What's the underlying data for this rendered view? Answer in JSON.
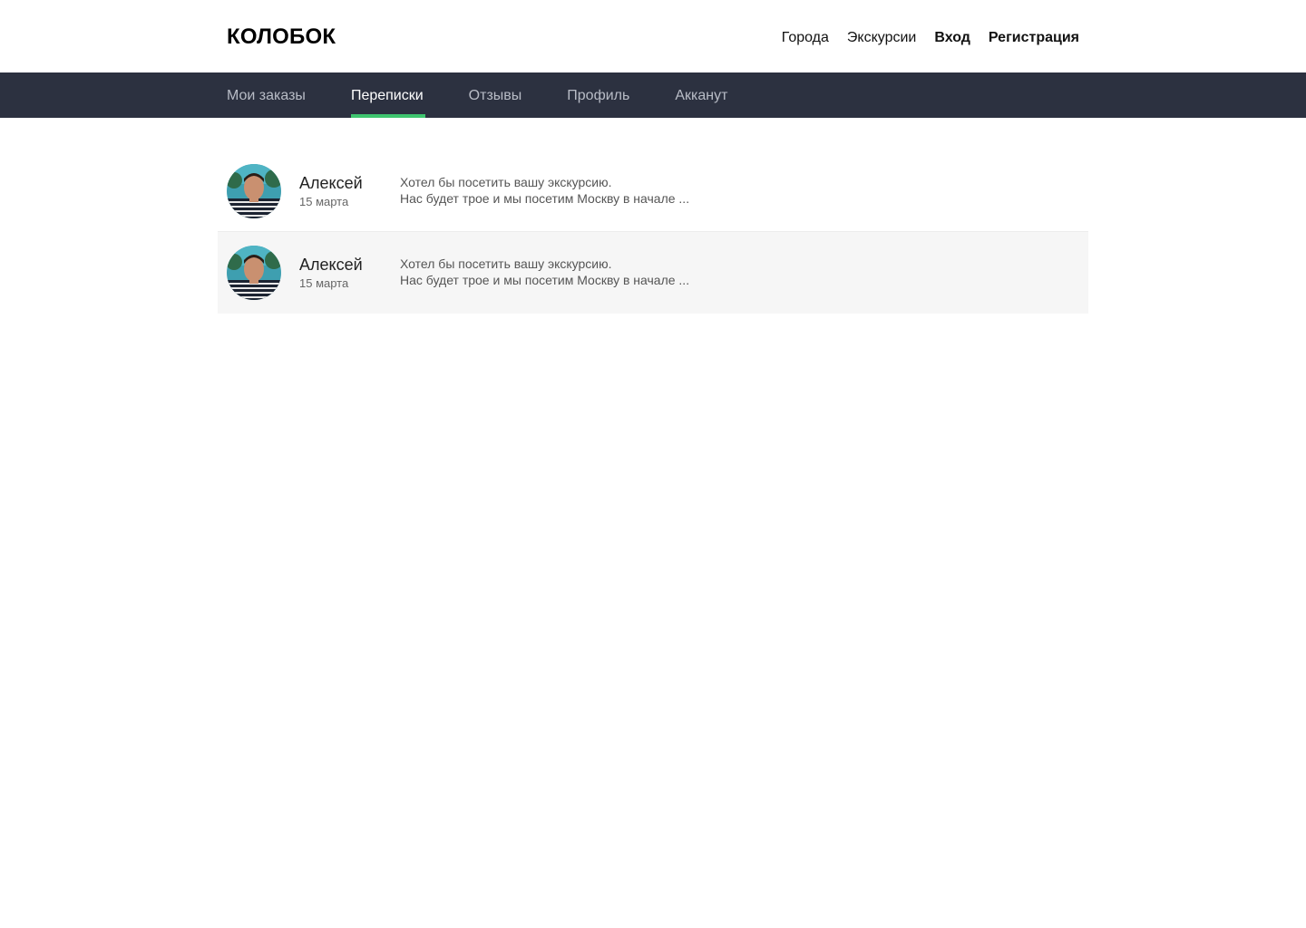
{
  "header": {
    "logo": "КОЛОБОК",
    "nav": [
      "Города",
      "Экскурсии"
    ],
    "login": "Вход",
    "register": "Регистрация"
  },
  "tabs": [
    {
      "label": "Мои заказы",
      "active": false
    },
    {
      "label": "Переписки",
      "active": true
    },
    {
      "label": "Отзывы",
      "active": false
    },
    {
      "label": "Профиль",
      "active": false
    },
    {
      "label": "Акканут",
      "active": false
    }
  ],
  "conversations": [
    {
      "name": "Алексей",
      "date": "15 марта",
      "preview_line1": "Хотел бы посетить вашу экскурсию.",
      "preview_line2": "Нас будет трое и мы посетим Москву в начале ..."
    },
    {
      "name": "Алексей",
      "date": "15 марта",
      "preview_line1": "Хотел бы посетить вашу экскурсию.",
      "preview_line2": "Нас будет трое и мы посетим Москву в начале ..."
    }
  ],
  "colors": {
    "subnav_bg": "#2c3140",
    "accent": "#3fc56f",
    "row_alt_bg": "#f6f6f6"
  }
}
